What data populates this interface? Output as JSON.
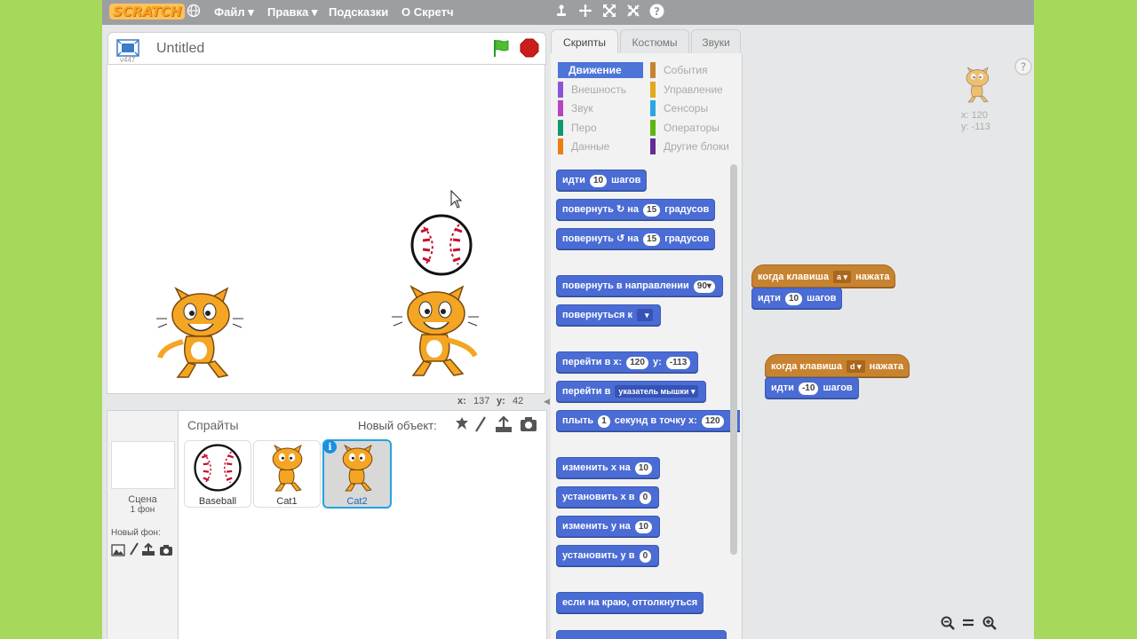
{
  "topbar": {
    "logo": "SCRATCH",
    "menu": [
      {
        "label": "Файл",
        "has_caret": true
      },
      {
        "label": "Правка",
        "has_caret": true
      },
      {
        "label": "Подсказки",
        "has_caret": false
      },
      {
        "label": "О Скретч",
        "has_caret": false
      }
    ],
    "tools": [
      "duplicate-icon",
      "delete-icon",
      "grow-icon",
      "shrink-icon",
      "help-icon"
    ]
  },
  "stage": {
    "version": "v447",
    "title": "Untitled",
    "mouse_x_label": "x:",
    "mouse_x": "137",
    "mouse_y_label": "y:",
    "mouse_y": "42"
  },
  "sprites_panel": {
    "title": "Спрайты",
    "new_object_label": "Новый объект:",
    "scene_label": "Сцена",
    "scene_count": "1 фон",
    "new_backdrop_label": "Новый фон:",
    "sprites": [
      {
        "name": "Baseball",
        "selected": false
      },
      {
        "name": "Cat1",
        "selected": false
      },
      {
        "name": "Cat2",
        "selected": true
      }
    ]
  },
  "tabs": [
    {
      "label": "Скрипты",
      "active": true
    },
    {
      "label": "Костюмы",
      "active": false
    },
    {
      "label": "Звуки",
      "active": false
    }
  ],
  "categories": [
    {
      "label": "Движение",
      "color": "#4c74d9",
      "active": true
    },
    {
      "label": "Внешность",
      "color": "#8a55d7",
      "active": false
    },
    {
      "label": "Звук",
      "color": "#bb42c3",
      "active": false
    },
    {
      "label": "Перо",
      "color": "#0e9a6c",
      "active": false
    },
    {
      "label": "Данные",
      "color": "#ee7d16",
      "active": false
    },
    {
      "label": "События",
      "color": "#c88330",
      "active": false
    },
    {
      "label": "Управление",
      "color": "#e1a91a",
      "active": false
    },
    {
      "label": "Сенсоры",
      "color": "#2ca5e2",
      "active": false
    },
    {
      "label": "Операторы",
      "color": "#5cb712",
      "active": false
    },
    {
      "label": "Другие блоки",
      "color": "#632d99",
      "active": false
    }
  ],
  "blocks": {
    "move": {
      "a": "идти",
      "n": "10",
      "b": "шагов"
    },
    "turn_right": {
      "a": "повернуть",
      "b": "на",
      "n": "15",
      "c": "градусов"
    },
    "turn_left": {
      "a": "повернуть",
      "b": "на",
      "n": "15",
      "c": "градусов"
    },
    "point_dir": {
      "a": "повернуть в направлении",
      "n": "90▾"
    },
    "point_towards": {
      "a": "повернуться к"
    },
    "goto_xy": {
      "a": "перейти в x:",
      "x": "120",
      "b": "y:",
      "y": "-113"
    },
    "goto": {
      "a": "перейти в",
      "d": "указатель мышки"
    },
    "glide": {
      "a": "плыть",
      "n": "1",
      "b": "секунд в точку x:",
      "x": "120"
    },
    "change_x": {
      "a": "изменить х на",
      "n": "10"
    },
    "set_x": {
      "a": "установить х в",
      "n": "0"
    },
    "change_y": {
      "a": "изменить у на",
      "n": "10"
    },
    "set_y": {
      "a": "установить у в",
      "n": "0"
    },
    "bounce": {
      "a": "если на краю, оттолкнуться"
    }
  },
  "scripts": {
    "sprite_x": "x: 120",
    "sprite_y": "y: -113",
    "script1": {
      "hat_a": "когда клавиша",
      "key": "a",
      "hat_b": "нажата",
      "move_a": "идти",
      "move_n": "10",
      "move_b": "шагов"
    },
    "script2": {
      "hat_a": "когда клавиша",
      "key": "d",
      "hat_b": "нажата",
      "move_a": "идти",
      "move_n": "-10",
      "move_b": "шагов"
    }
  }
}
